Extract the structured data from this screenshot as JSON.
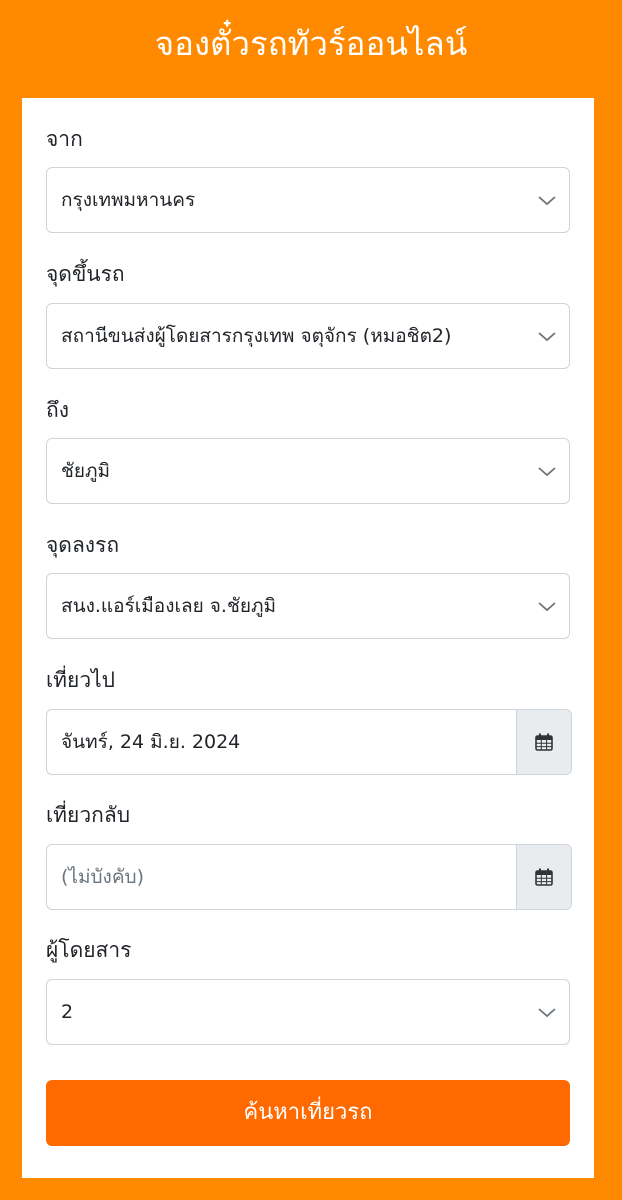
{
  "header": {
    "title": "จองตั๋วรถทัวร์ออนไลน์"
  },
  "form": {
    "from": {
      "label": "จาก",
      "value": "กรุงเทพมหานคร"
    },
    "pickup": {
      "label": "จุดขึ้นรถ",
      "value": "สถานีขนส่งผู้โดยสารกรุงเทพ จตุจักร (หมอชิต2)"
    },
    "to": {
      "label": "ถึง",
      "value": "ชัยภูมิ"
    },
    "dropoff": {
      "label": "จุดลงรถ",
      "value": "สนง.แอร์เมืองเลย จ.ชัยภูมิ"
    },
    "departure": {
      "label": "เที่ยวไป",
      "value": "จันทร์, 24 มิ.ย. 2024"
    },
    "return": {
      "label": "เที่ยวกลับ",
      "placeholder": "(ไม่บังคับ)"
    },
    "passengers": {
      "label": "ผู้โดยสาร",
      "value": "2"
    },
    "search_label": "ค้นหาเที่ยวรถ"
  },
  "icons": {
    "select_arrow": "chevron-down-icon",
    "date_picker": "calendar-icon"
  },
  "colors": {
    "background": "#FF8A00",
    "button": "#FF6A00",
    "addon": "#e9ecef"
  }
}
